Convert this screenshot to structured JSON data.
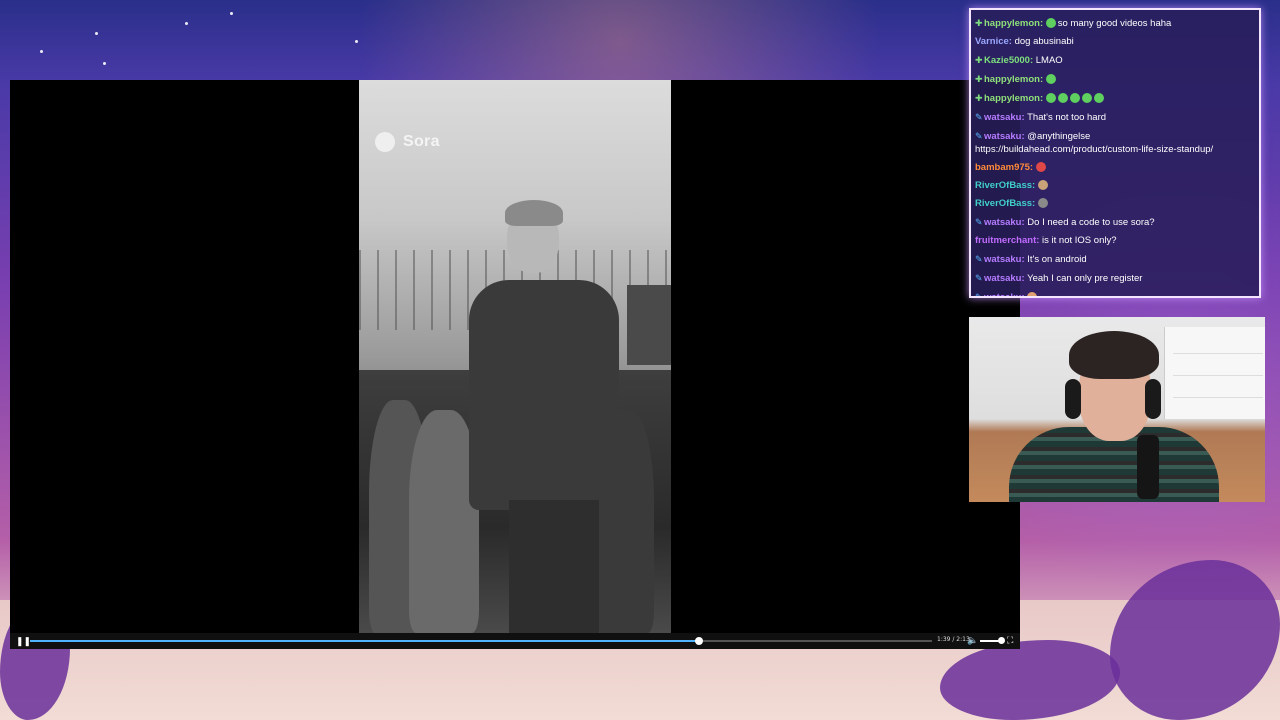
{
  "video": {
    "watermark": "Sora",
    "progress_fraction": 0.742,
    "time_label": "1:39 / 2:13"
  },
  "player_controls": {
    "play_pause_icon": "pause-icon",
    "volume_icon": "volume-icon",
    "fullscreen_icon": "fullscreen-icon"
  },
  "chat": {
    "messages": [
      {
        "user": "happylemon:",
        "badge": "green",
        "user_color": "#8fe07a",
        "text": "so many good videos haha",
        "emote": "#5fcf5f"
      },
      {
        "user": "Varnice:",
        "badge": "",
        "user_color": "#9aa7ff",
        "text": "dog abusinabi",
        "emote": ""
      },
      {
        "user": "Kazie5000:",
        "badge": "green",
        "user_color": "#7de07d",
        "text": "LMAO",
        "emote": ""
      },
      {
        "user": "happylemon:",
        "badge": "green",
        "user_color": "#8fe07a",
        "text": "",
        "emote": "#5fcf5f"
      },
      {
        "user": "happylemon:",
        "badge": "green",
        "user_color": "#8fe07a",
        "text": "",
        "emote": "#5fcf5f",
        "emote_count": 5
      },
      {
        "user": "watsaku:",
        "badge": "blue",
        "user_color": "#b57cff",
        "text": "That's not too hard",
        "emote": ""
      },
      {
        "user": "watsaku:",
        "badge": "blue",
        "user_color": "#b57cff",
        "text": "@anythingelse https://buildahead.com/product/custom-life-size-standup/",
        "emote": "",
        "wrap": true
      },
      {
        "user": "bambam975:",
        "badge": "",
        "user_color": "#ff8a3a",
        "text": "",
        "emote": "#e04848"
      },
      {
        "user": "RiverOfBass:",
        "badge": "",
        "user_color": "#3fd0c8",
        "text": "",
        "emote": "#c9a27a"
      },
      {
        "user": "RiverOfBass:",
        "badge": "",
        "user_color": "#3fd0c8",
        "text": "",
        "emote": "#8a8a8a"
      },
      {
        "user": "watsaku:",
        "badge": "blue",
        "user_color": "#b57cff",
        "text": "Do I need a code to use sora?",
        "emote": ""
      },
      {
        "user": "fruitmerchant:",
        "badge": "",
        "user_color": "#c06cff",
        "text": "is it not IOS only?",
        "emote": ""
      },
      {
        "user": "watsaku:",
        "badge": "blue",
        "user_color": "#b57cff",
        "text": "It's on android",
        "emote": ""
      },
      {
        "user": "watsaku:",
        "badge": "blue",
        "user_color": "#b57cff",
        "text": "Yeah I can only pre register",
        "emote": ""
      },
      {
        "user": "watsaku:",
        "badge": "blue",
        "user_color": "#b57cff",
        "text": "",
        "emote": "#e0a070"
      }
    ]
  },
  "colors": {
    "chat_border": "#f4e6ff",
    "progress": "#4fb3ff"
  }
}
